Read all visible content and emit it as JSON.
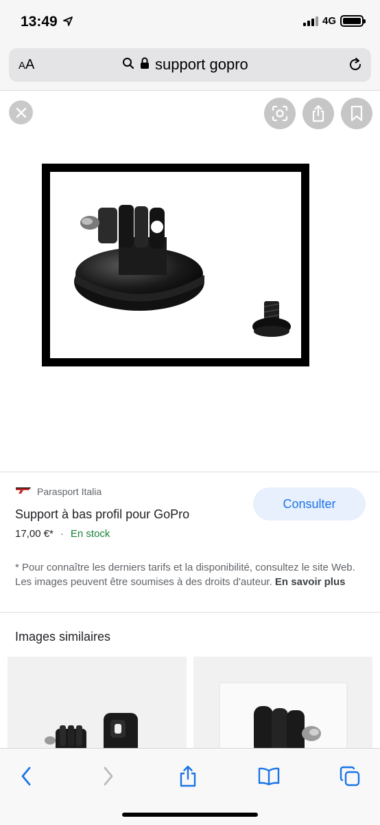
{
  "status": {
    "time": "13:49",
    "network": "4G"
  },
  "browser": {
    "text_size": "AA",
    "url": "support gopro"
  },
  "product": {
    "source": "Parasport Italia",
    "title": "Support à bas profil pour GoPro",
    "price": "17,00 €*",
    "separator": "·",
    "availability": "En stock",
    "consult_label": "Consulter"
  },
  "disclaimer": {
    "text": "* Pour connaître les derniers tarifs et la disponibilité, consultez le site Web. Les images peuvent être soumises à des droits d'auteur. ",
    "link": "En savoir plus"
  },
  "similar": {
    "title": "Images similaires"
  },
  "icons": {
    "location": "location-arrow-icon",
    "search": "search-icon",
    "lock": "lock-icon",
    "reload": "reload-icon",
    "close": "close-icon",
    "lens": "lens-icon",
    "share": "share-icon",
    "bookmark": "bookmark-icon",
    "back": "back-icon",
    "forward": "forward-icon",
    "book": "book-icon",
    "tabs": "tabs-icon"
  },
  "colors": {
    "accent": "#1a73e8",
    "stock": "#188038",
    "button_bg": "#e8f0fe"
  }
}
